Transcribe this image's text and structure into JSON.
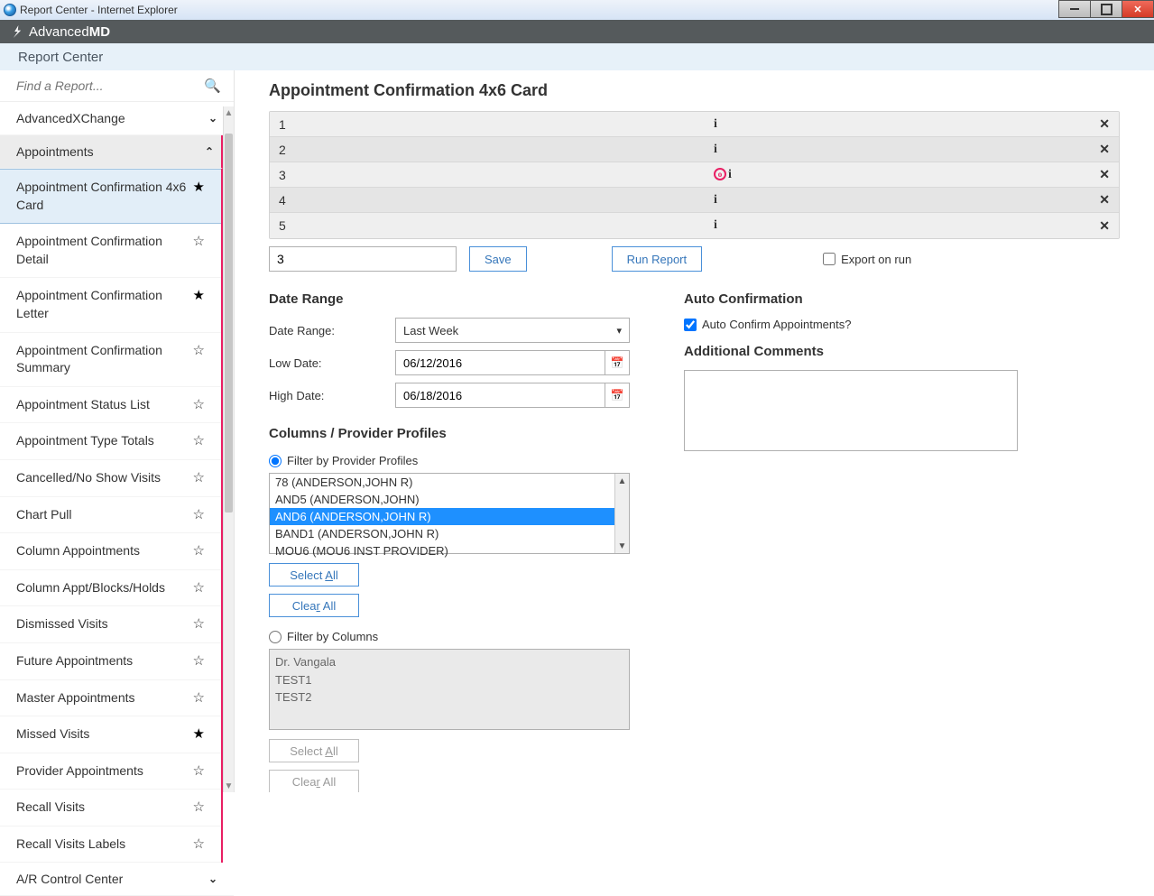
{
  "window": {
    "title": "Report Center - Internet Explorer"
  },
  "brand": {
    "name_light": "Advanced",
    "name_bold": "MD"
  },
  "subheader": "Report Center",
  "search": {
    "placeholder": "Find a Report..."
  },
  "navGroups": {
    "advx": "AdvancedXChange",
    "appts": "Appointments",
    "arcontrol": "A/R Control Center"
  },
  "navItems": {
    "conf4x6": "Appointment Confirmation 4x6 Card",
    "confdetail": "Appointment Confirmation Detail",
    "confletter": "Appointment Confirmation Letter",
    "confsummary": "Appointment Confirmation Summary",
    "statuslist": "Appointment Status List",
    "typetotals": "Appointment Type Totals",
    "cancelled": "Cancelled/No Show Visits",
    "chartpull": "Chart Pull",
    "colappts": "Column Appointments",
    "colblocks": "Column Appt/Blocks/Holds",
    "dismissed": "Dismissed Visits",
    "future": "Future Appointments",
    "master": "Master Appointments",
    "missed": "Missed Visits",
    "provider": "Provider Appointments",
    "recall": "Recall Visits",
    "recalllabels": "Recall Visits Labels"
  },
  "content": {
    "title": "Appointment Confirmation 4x6 Card",
    "rows": {
      "r1": "1",
      "r2": "2",
      "r3": "3",
      "r4": "4",
      "r5": "5"
    },
    "inputValue": "3",
    "saveBtn": "Save",
    "runBtn": "Run Report",
    "exportLabel": "Export on run"
  },
  "dateRange": {
    "title": "Date Range",
    "labelRange": "Date Range:",
    "labelLow": "Low Date:",
    "labelHigh": "High Date:",
    "rangeValue": "Last Week",
    "lowDate": "06/12/2016",
    "highDate": "06/18/2016"
  },
  "profiles": {
    "title": "Columns / Provider Profiles",
    "radioProfiles": "Filter by Provider Profiles",
    "radioColumns": "Filter by Columns",
    "list": {
      "p1": "78 (ANDERSON,JOHN R)",
      "p2": "AND5 (ANDERSON,JOHN)",
      "p3": "AND6 (ANDERSON,JOHN R)",
      "p4": "BAND1 (ANDERSON,JOHN R)",
      "p5": "MOU6 (MOU6 INST PROVIDER)"
    },
    "selectAll_pre": "Select ",
    "selectAll_u": "A",
    "selectAll_post": "ll",
    "clearAll_pre": "Clea",
    "clearAll_u": "r",
    "clearAll_post": " All",
    "columnsList": {
      "c1": "Dr. Vangala",
      "c2": "TEST1",
      "c3": "TEST2"
    }
  },
  "autoconf": {
    "title": "Auto Confirmation",
    "checkLabel": "Auto Confirm Appointments?",
    "commentsTitle": "Additional Comments"
  }
}
